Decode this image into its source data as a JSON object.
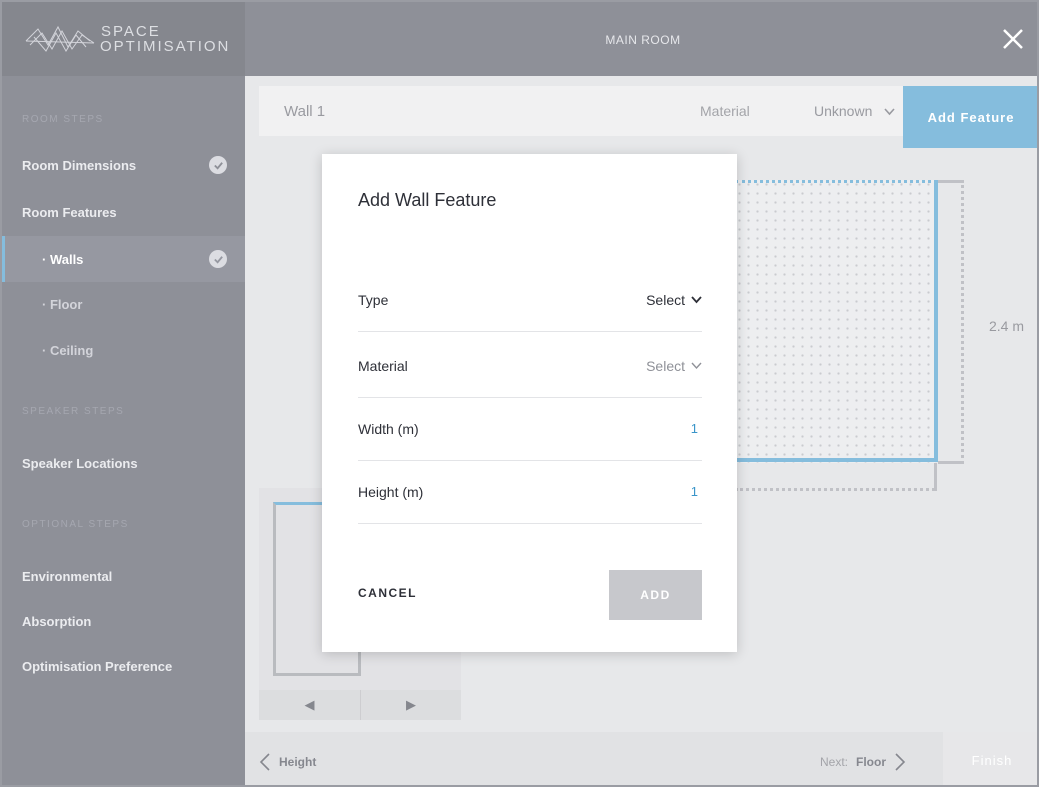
{
  "app": {
    "logo_line1": "SPACE",
    "logo_line2": "OPTIMISATION",
    "title": "MAIN ROOM"
  },
  "sidebar": {
    "sections": [
      {
        "heading": "ROOM STEPS"
      },
      {
        "heading": "SPEAKER STEPS"
      },
      {
        "heading": "OPTIONAL STEPS"
      }
    ],
    "items": [
      {
        "label": "Room Dimensions",
        "completed": true
      },
      {
        "label": "Room Features",
        "completed": false
      },
      {
        "label": "· Walls",
        "completed": true,
        "active": true
      },
      {
        "label": "· Floor",
        "completed": false
      },
      {
        "label": "· Ceiling",
        "completed": false
      },
      {
        "label": "Speaker Locations",
        "completed": false
      },
      {
        "label": "Environmental",
        "completed": false
      },
      {
        "label": "Absorption",
        "completed": false
      },
      {
        "label": "Optimisation Preference",
        "completed": false
      }
    ]
  },
  "wallbar": {
    "wall_name": "Wall 1",
    "material_label": "Material",
    "material_value": "Unknown",
    "add_feature_label": "Add Feature"
  },
  "canvas": {
    "height_dimension": "2.4 m"
  },
  "bottombar": {
    "back_label": "Height",
    "next_prefix": "Next: ",
    "next_label": "Floor",
    "finish_label": "Finish"
  },
  "modal": {
    "title": "Add Wall Feature",
    "fields": [
      {
        "label": "Type",
        "value": "Select"
      },
      {
        "label": "Material",
        "value": "Select"
      },
      {
        "label": "Width (m)",
        "value": "1"
      },
      {
        "label": "Height (m)",
        "value": "1"
      }
    ],
    "cancel_label": "CANCEL",
    "add_label": "ADD"
  },
  "colors": {
    "accent": "#3a95c9",
    "sidebar_bg": "#4a4d5a",
    "header_bg": "#3b3e4a"
  }
}
